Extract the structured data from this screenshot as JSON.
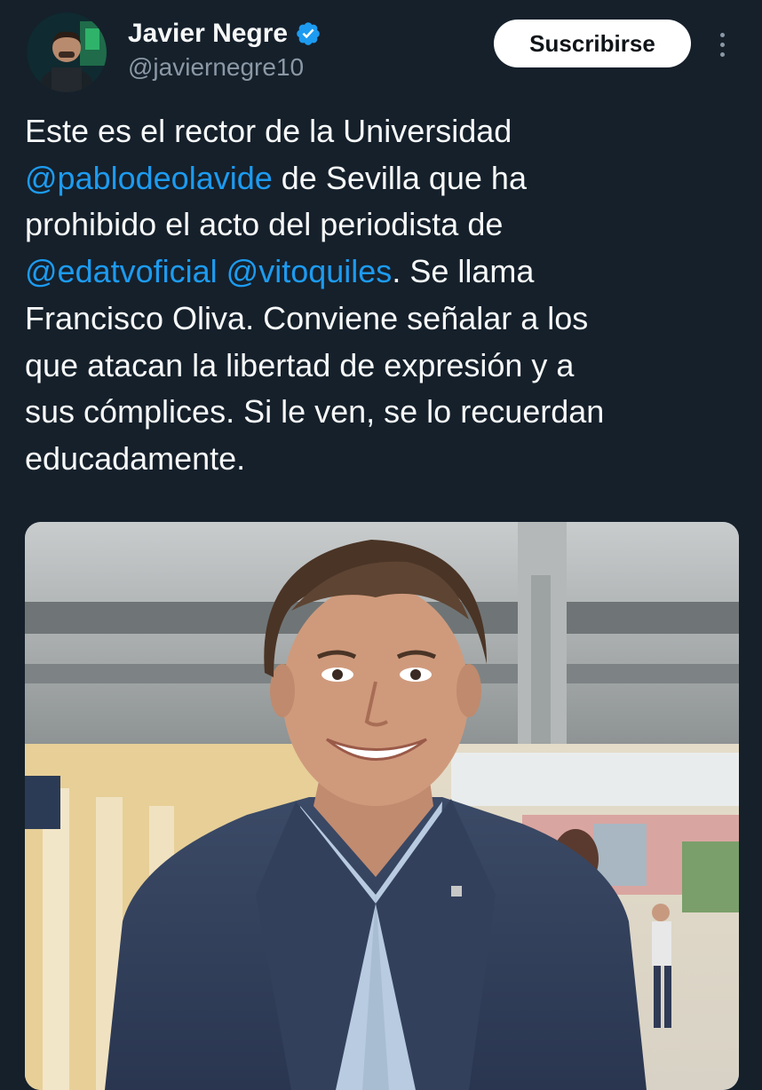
{
  "author": {
    "display_name": "Javier Negre",
    "handle": "@javiernegre10",
    "verified": true,
    "avatar_icon": "profile-photo"
  },
  "actions": {
    "subscribe_label": "Suscribirse",
    "more_icon": "more-vertical-icon"
  },
  "tweet": {
    "lines": [
      [
        {
          "text": "Este es el rector de la Universidad",
          "mention": false
        }
      ],
      [
        {
          "text": "@pablodeolavide",
          "mention": true
        },
        {
          "text": " de Sevilla que ha",
          "mention": false
        }
      ],
      [
        {
          "text": "prohibido el acto del periodista de",
          "mention": false
        }
      ],
      [
        {
          "text": "@edatvoficial",
          "mention": true
        },
        {
          "text": " ",
          "mention": false
        },
        {
          "text": "@vitoquiles",
          "mention": true
        },
        {
          "text": ". Se llama",
          "mention": false
        }
      ],
      [
        {
          "text": "Francisco Oliva. Conviene señalar a los",
          "mention": false
        }
      ],
      [
        {
          "text": "que atacan la libertad de expresión y a",
          "mention": false
        }
      ],
      [
        {
          "text": "sus cómplices. Si le ven, se lo recuerdan",
          "mention": false
        }
      ],
      [
        {
          "text": "educadamente.",
          "mention": false
        }
      ]
    ]
  },
  "media": {
    "type": "photo",
    "subject": "portrait-photo"
  },
  "colors": {
    "background": "#15202b",
    "text": "#f7f9f9",
    "secondary": "#8b98a5",
    "mention": "#1d9bf0",
    "verified": "#1d9bf0"
  }
}
